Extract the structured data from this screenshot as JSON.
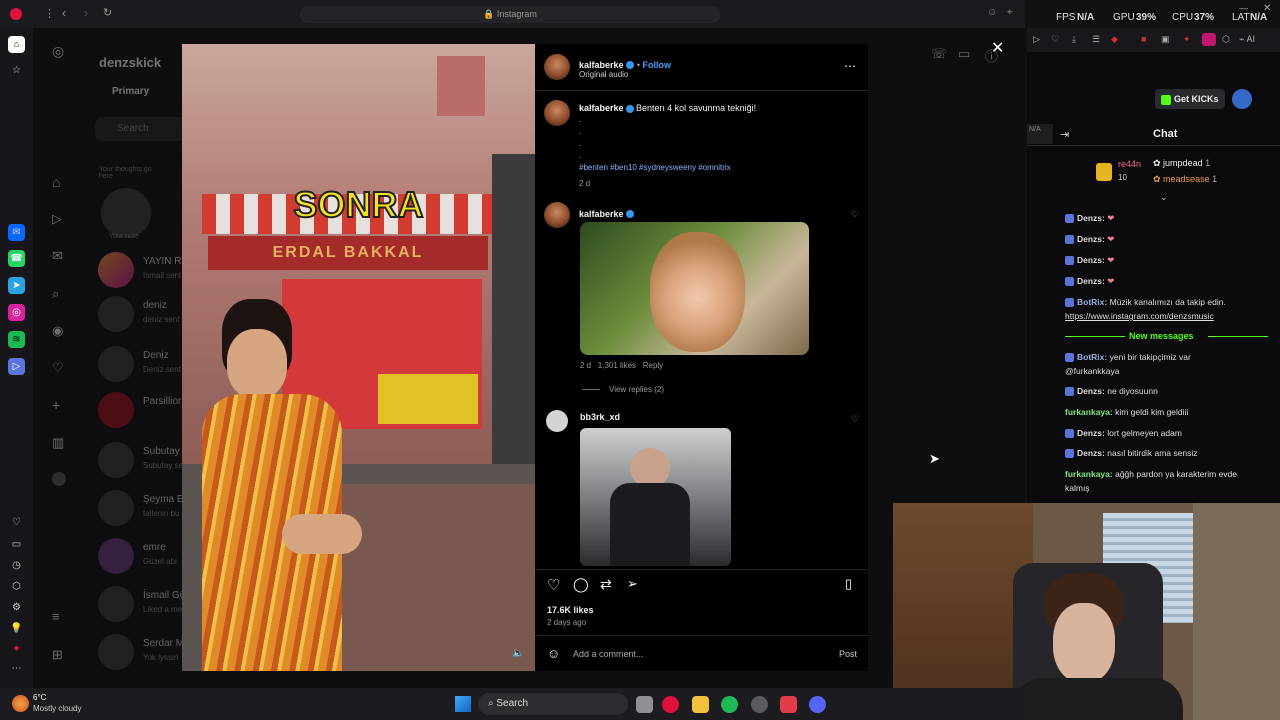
{
  "browser": {
    "address": "Instagram",
    "accent": "#e0123d"
  },
  "system_overlay": {
    "fps_label": "FPS",
    "fps_value": "N/A",
    "gpu_label": "GPU",
    "gpu_value": "39%",
    "cpu_label": "CPU",
    "cpu_value": "37%",
    "lat_label": "LAT",
    "lat_value": "N/A",
    "right_label": "AI"
  },
  "instagram": {
    "account": "denzskick",
    "tab_primary": "Primary",
    "search_placeholder": "Search",
    "note_1": "Your thoughts go here",
    "note_label": "Your note",
    "dm_list": [
      {
        "name": "YAYIN RE",
        "sub": "İsmail sent"
      },
      {
        "name": "deniz",
        "sub": "deniz sent"
      },
      {
        "name": "Deniz",
        "sub": "Deniz sent"
      },
      {
        "name": "Parsillior",
        "sub": ""
      },
      {
        "name": "Subutay",
        "sub": "Subutay se"
      },
      {
        "name": "Şeyma Er",
        "sub": "tallenin bu"
      },
      {
        "name": "emre",
        "sub": "Güzel abi"
      },
      {
        "name": "İsmail Gü",
        "sub": "Liked a me"
      },
      {
        "name": "Serdar M",
        "sub": "Yok lyssin"
      }
    ]
  },
  "video": {
    "overlay_text": "SONRA",
    "shop_sign": "ERDAL BAKKAL"
  },
  "post": {
    "author": "kalfaberke",
    "follow": "Follow",
    "audio": "Original audio",
    "caption_author": "kalfaberke",
    "caption": "Benten 4 kol savunma tekniği!",
    "dots": ".",
    "hashtags": "#benten #ben10 #sydneysweeny #omnitrix",
    "caption_time": "2 d",
    "comments": [
      {
        "author": "kalfaberke",
        "time": "2 d",
        "likes": "1,301 likes",
        "reply": "Reply",
        "view_replies": "View replies (2)"
      },
      {
        "author": "bb3rk_xd"
      }
    ],
    "likes": "17.6K likes",
    "posted": "2 days ago",
    "comment_placeholder": "Add a comment...",
    "post_button": "Post"
  },
  "chat": {
    "get_kicks": "Get KICKs",
    "title": "Chat",
    "leaderboard": {
      "first_name": "re44n",
      "first_score": "10",
      "second_name": "jumpdead",
      "second_score": "1",
      "third_name": "meadsease",
      "third_score": "1"
    },
    "messages": [
      {
        "user": "Denzs:",
        "text": "",
        "color": "#ffffff"
      },
      {
        "user": "Denzs:",
        "text": "",
        "color": "#ffffff"
      },
      {
        "user": "Denzs:",
        "text": "",
        "color": "#ffffff"
      },
      {
        "user": "Denzs:",
        "text": "",
        "color": "#ffffff"
      },
      {
        "user": "BotRix:",
        "text": "Müzik kanalımızı da takip edin.",
        "color": "#ffffff"
      }
    ],
    "link": "https://www.instagram.com/denzsmusic",
    "new_messages": "New messages",
    "new_list": [
      {
        "user": "BotRix:",
        "text": "yeni bir takipçimiz var",
        "color": "#ffffff"
      },
      {
        "user": "",
        "text": "@furkankkaya",
        "color": "#ffffff"
      },
      {
        "user": "Denzs:",
        "text": "ne diyosuunn",
        "color": "#ffffff"
      },
      {
        "user": "furkankaya:",
        "text": "kim geldi kim geldiii",
        "color": "#7ee787"
      },
      {
        "user": "Denzs:",
        "text": "lort gelmeyen adam",
        "color": "#ffffff"
      },
      {
        "user": "Denzs:",
        "text": "nasıl bitirdik ama sensiz",
        "color": "#ffffff"
      },
      {
        "user": "furkankaya:",
        "text": "ağğh pardon ya karakterim evde",
        "color": "#7ee787"
      },
      {
        "user": "",
        "text": "kalmış",
        "color": "#ffffff"
      }
    ]
  },
  "taskbar": {
    "temperature": "6°C",
    "weather": "Mostly cloudy",
    "search": "Search"
  }
}
